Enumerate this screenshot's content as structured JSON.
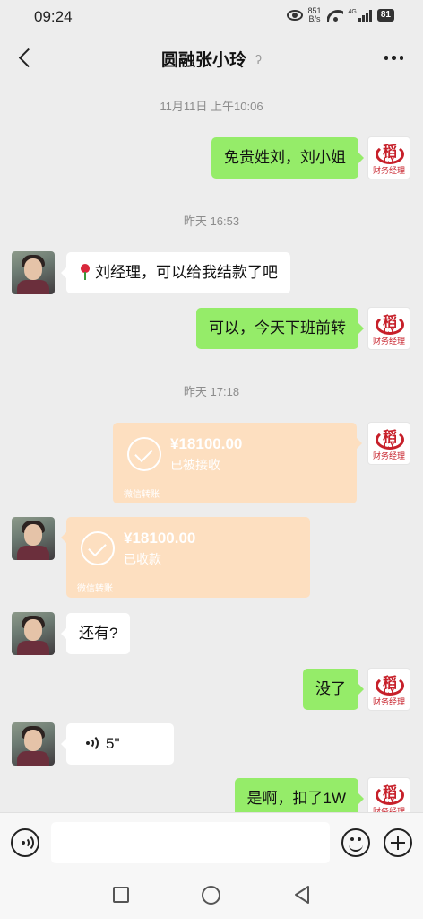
{
  "status": {
    "time": "09:24",
    "speed_value": "851",
    "speed_unit": "B/s",
    "network": "4G",
    "battery": "81"
  },
  "header": {
    "title": "圆融张小玲"
  },
  "timestamps": [
    "11月11日 上午10:06",
    "昨天 16:53",
    "昨天 17:18"
  ],
  "me_avatar_caption": "财务经理",
  "me_avatar_logo_char": "稻",
  "me_avatar_logo_letters": "CY",
  "messages": {
    "m1": "免贵姓刘，刘小姐",
    "m2": "刘经理，可以给我结款了吧",
    "m3": "可以，今天下班前转",
    "m4": "还有?",
    "m5": "没了",
    "m6_duration": "5\"",
    "m7": "是啊，扣了1W"
  },
  "transfers": {
    "t1": {
      "amount": "¥18100.00",
      "status": "已被接收",
      "source": "微信转账"
    },
    "t2": {
      "amount": "¥18100.00",
      "status": "已收款",
      "source": "微信转账"
    }
  },
  "input": {
    "placeholder": ""
  }
}
